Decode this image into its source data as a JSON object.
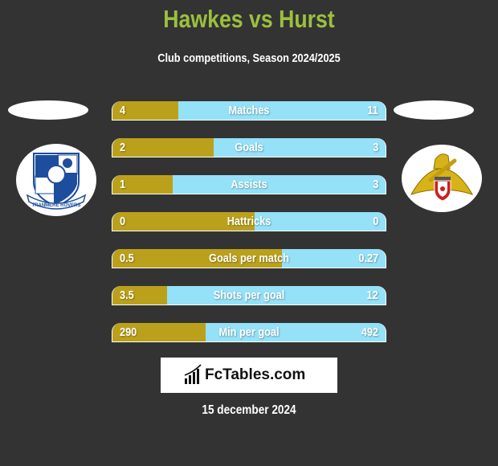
{
  "header": {
    "title": "Hawkes vs Hurst",
    "subtitle": "Club competitions, Season 2024/2025"
  },
  "players": {
    "left": {
      "team_logo": "tranmere-rovers-crest",
      "badge_text": "TRANMERE ROVERS"
    },
    "right": {
      "team_logo": "doncaster-rovers-crest"
    }
  },
  "colors": {
    "left_fill": "#bba11b",
    "right_fill": "#94e1f8",
    "title": "#9cbf3f",
    "background": "#333333"
  },
  "stats": [
    {
      "label": "Matches",
      "left": "4",
      "right": "11",
      "left_share": 0.24
    },
    {
      "label": "Goals",
      "left": "2",
      "right": "3",
      "left_share": 0.37
    },
    {
      "label": "Assists",
      "left": "1",
      "right": "3",
      "left_share": 0.22
    },
    {
      "label": "Hattricks",
      "left": "0",
      "right": "0",
      "left_share": 0.52
    },
    {
      "label": "Goals per match",
      "left": "0.5",
      "right": "0.27",
      "left_share": 0.62
    },
    {
      "label": "Shots per goal",
      "left": "3.5",
      "right": "12",
      "left_share": 0.2
    },
    {
      "label": "Min per goal",
      "left": "290",
      "right": "492",
      "left_share": 0.34
    }
  ],
  "brand": {
    "name": "FcTables.com",
    "icon": "bar-chart-icon"
  },
  "footer": {
    "date": "15 december 2024"
  }
}
